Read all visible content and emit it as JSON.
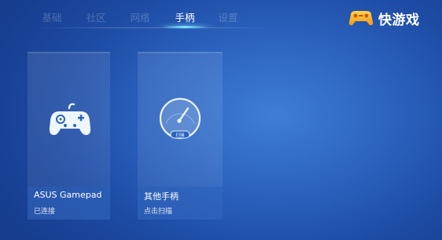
{
  "nav": {
    "tabs": [
      {
        "label": "基础",
        "active": false
      },
      {
        "label": "社区",
        "active": false
      },
      {
        "label": "网络",
        "active": false
      },
      {
        "label": "手柄",
        "active": true
      },
      {
        "label": "设置",
        "active": false
      }
    ]
  },
  "brand": {
    "name": "快游戏",
    "logo_icon": "game-controller-logo-icon"
  },
  "cards": [
    {
      "title": "ASUS Gamepad",
      "subtitle": "已连接",
      "icon": "gamepad-icon"
    },
    {
      "title": "其他手柄",
      "subtitle": "点击扫描",
      "icon": "speedometer-icon",
      "gauge_label": "扫描"
    }
  ],
  "colors": {
    "background": "#2b63bf",
    "active_tab_underline": "#7fe3ff",
    "logo_orange": "#f7a81e",
    "icon_white": "#eef6ff"
  }
}
